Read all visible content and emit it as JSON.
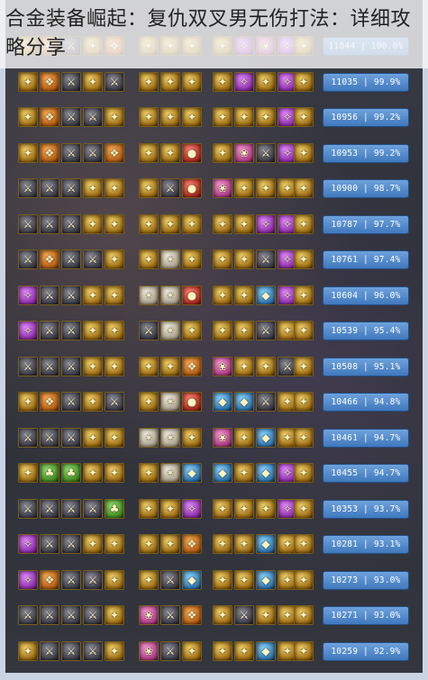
{
  "page": {
    "title": "合金装备崛起：复仇双叉男无伤打法：详细攻略分享"
  },
  "rows": [
    {
      "score": "11044",
      "percent": "100.0%",
      "icons": [
        "gold",
        "orange",
        "dark",
        "gold",
        "orange",
        "gold",
        "gold",
        "gold",
        "gold",
        "purple",
        "pink",
        "purple",
        "gold"
      ]
    },
    {
      "score": "11035",
      "percent": "99.9%",
      "icons": [
        "gold",
        "orange",
        "dark",
        "gold",
        "dark",
        "gold",
        "gold",
        "gold",
        "gold",
        "purple",
        "gold",
        "purple",
        "gold"
      ]
    },
    {
      "score": "10956",
      "percent": "99.2%",
      "icons": [
        "gold",
        "orange",
        "dark",
        "dark",
        "gold",
        "gold",
        "gold",
        "gold",
        "gold",
        "gold",
        "gold",
        "purple",
        "gold"
      ]
    },
    {
      "score": "10953",
      "percent": "99.2%",
      "icons": [
        "gold",
        "orange",
        "dark",
        "dark",
        "orange",
        "gold",
        "gold",
        "red",
        "gold",
        "pink",
        "dark",
        "purple",
        "gold"
      ]
    },
    {
      "score": "10900",
      "percent": "98.7%",
      "icons": [
        "dark",
        "dark",
        "dark",
        "gold",
        "gold",
        "gold",
        "dark",
        "red",
        "pink",
        "gold",
        "gold",
        "gold",
        "gold"
      ]
    },
    {
      "score": "10787",
      "percent": "97.7%",
      "icons": [
        "dark",
        "dark",
        "dark",
        "gold",
        "gold",
        "gold",
        "gold",
        "gold",
        "gold",
        "gold",
        "purple",
        "purple",
        "gold"
      ]
    },
    {
      "score": "10761",
      "percent": "97.4%",
      "icons": [
        "dark",
        "orange",
        "dark",
        "dark",
        "gold",
        "gold",
        "white",
        "gold",
        "gold",
        "gold",
        "dark",
        "purple",
        "gold"
      ]
    },
    {
      "score": "10604",
      "percent": "96.0%",
      "icons": [
        "purple",
        "dark",
        "dark",
        "gold",
        "gold",
        "white",
        "white",
        "red",
        "gold",
        "gold",
        "blue",
        "purple",
        "gold"
      ]
    },
    {
      "score": "10539",
      "percent": "95.4%",
      "icons": [
        "purple",
        "dark",
        "dark",
        "gold",
        "gold",
        "dark",
        "white",
        "gold",
        "gold",
        "gold",
        "dark",
        "gold",
        "gold"
      ]
    },
    {
      "score": "10508",
      "percent": "95.1%",
      "icons": [
        "dark",
        "dark",
        "dark",
        "gold",
        "gold",
        "gold",
        "gold",
        "orange",
        "pink",
        "gold",
        "gold",
        "dark",
        "gold"
      ]
    },
    {
      "score": "10466",
      "percent": "94.8%",
      "icons": [
        "gold",
        "orange",
        "dark",
        "gold",
        "dark",
        "gold",
        "white",
        "red",
        "blue",
        "blue",
        "dark",
        "gold",
        "gold"
      ]
    },
    {
      "score": "10461",
      "percent": "94.7%",
      "icons": [
        "dark",
        "dark",
        "dark",
        "gold",
        "gold",
        "white",
        "white",
        "gold",
        "pink",
        "gold",
        "blue",
        "gold",
        "gold"
      ]
    },
    {
      "score": "10455",
      "percent": "94.7%",
      "icons": [
        "gold",
        "green",
        "green",
        "gold",
        "gold",
        "gold",
        "white",
        "blue",
        "blue",
        "gold",
        "blue",
        "purple",
        "gold"
      ]
    },
    {
      "score": "10353",
      "percent": "93.7%",
      "icons": [
        "dark",
        "dark",
        "dark",
        "dark",
        "green",
        "gold",
        "gold",
        "purple",
        "gold",
        "gold",
        "gold",
        "purple",
        "gold"
      ]
    },
    {
      "score": "10281",
      "percent": "93.1%",
      "icons": [
        "purple",
        "dark",
        "dark",
        "gold",
        "gold",
        "gold",
        "gold",
        "orange",
        "gold",
        "gold",
        "blue",
        "gold",
        "gold"
      ]
    },
    {
      "score": "10273",
      "percent": "93.0%",
      "icons": [
        "purple",
        "orange",
        "dark",
        "dark",
        "gold",
        "gold",
        "dark",
        "blue",
        "gold",
        "gold",
        "blue",
        "gold",
        "gold"
      ]
    },
    {
      "score": "10271",
      "percent": "93.0%",
      "icons": [
        "dark",
        "dark",
        "dark",
        "dark",
        "gold",
        "pink",
        "dark",
        "orange",
        "gold",
        "dark",
        "gold",
        "gold",
        "gold"
      ]
    },
    {
      "score": "10259",
      "percent": "92.9%",
      "icons": [
        "gold",
        "dark",
        "dark",
        "dark",
        "gold",
        "pink",
        "dark",
        "gold",
        "gold",
        "gold",
        "blue",
        "gold",
        "gold"
      ]
    }
  ]
}
